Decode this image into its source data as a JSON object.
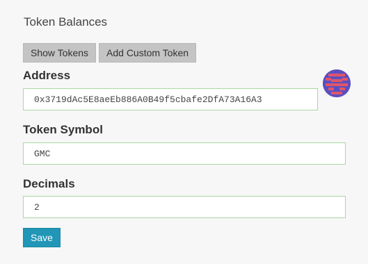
{
  "panel": {
    "title": "Token Balances"
  },
  "tabs": [
    {
      "label": "Show Tokens"
    },
    {
      "label": "Add Custom Token"
    }
  ],
  "form": {
    "address": {
      "label": "Address",
      "value": "0x3719dAc5E8aeEb886A0B49f5cbafe2DfA73A16A3"
    },
    "symbol": {
      "label": "Token Symbol",
      "value": "GMC"
    },
    "decimals": {
      "label": "Decimals",
      "value": "2"
    },
    "save_label": "Save"
  },
  "identicon": {
    "icon": "address-identicon",
    "colors": [
      "#5b4fbf",
      "#e0566a"
    ]
  },
  "colors": {
    "accent": "#2196b6",
    "field_border": "#a8d8a0",
    "tab_bg": "#c4c4c4",
    "page_bg": "#f7f7f7"
  }
}
